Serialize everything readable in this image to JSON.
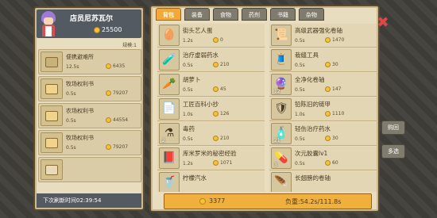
{
  "shop": {
    "title": "店员尼苏瓦尔",
    "coins": "25500",
    "level": "规模:1",
    "items": [
      {
        "name": "便携避难所",
        "time": "12.5s",
        "price": "6435"
      },
      {
        "name": "牧场权利书",
        "time": "0.5s",
        "price": "79207"
      },
      {
        "name": "农场权利书",
        "time": "0.5s",
        "price": "44554"
      },
      {
        "name": "牧场权利书",
        "time": "0.5s",
        "price": "79207"
      }
    ],
    "refresh": "下次刷新时间02:39:54"
  },
  "tabs": [
    "背包",
    "装备",
    "食物",
    "药剂",
    "书籍",
    "杂物"
  ],
  "active_tab": 0,
  "bag": {
    "items": [
      {
        "name": "街头艺人蛋",
        "time": "1.2s",
        "price": "0",
        "count": "",
        "icon": "egg-icon",
        "glyph": "🥚"
      },
      {
        "name": "高级武器强化卷轴",
        "time": "0.5s",
        "price": "1470",
        "count": "",
        "icon": "scroll-icon",
        "glyph": "📜"
      },
      {
        "name": "治疗虚弱药水",
        "time": "0.5s",
        "price": "210",
        "count": "",
        "icon": "potion-icon",
        "glyph": "🧪"
      },
      {
        "name": "栽缝工具",
        "time": "0.5s",
        "price": "30",
        "count": "",
        "icon": "sewing-tool-icon",
        "glyph": "🧵"
      },
      {
        "name": "胡萝卜",
        "time": "0.5s",
        "price": "45",
        "count": "",
        "icon": "carrot-icon",
        "glyph": "🥕"
      },
      {
        "name": "全净化卷轴",
        "time": "0.5s",
        "price": "147",
        "count": "12",
        "icon": "purify-scroll-icon",
        "glyph": "🔮"
      },
      {
        "name": "工匠百科小抄",
        "time": "1.0s",
        "price": "126",
        "count": "",
        "icon": "note-icon",
        "glyph": "📄"
      },
      {
        "name": "铅陈旧的链甲",
        "time": "1.0s",
        "price": "1110",
        "count": "",
        "icon": "armor-icon",
        "glyph": "🛡"
      },
      {
        "name": "毒药",
        "time": "0.5s",
        "price": "210",
        "count": "2",
        "icon": "poison-icon",
        "glyph": "⚗"
      },
      {
        "name": "轻伤治疗药水",
        "time": "0.5s",
        "price": "30",
        "count": "21",
        "icon": "heal-potion-icon",
        "glyph": "🧴"
      },
      {
        "name": "库米罗米的秘密经验",
        "time": "1.2s",
        "price": "1071",
        "count": "",
        "icon": "book-icon",
        "glyph": "📕"
      },
      {
        "name": "次元胶囊lv1",
        "time": "0.5s",
        "price": "60",
        "count": "3",
        "icon": "capsule-icon",
        "glyph": "💊"
      },
      {
        "name": "柠檬汽水",
        "time": "",
        "price": "",
        "count": "",
        "icon": "soda-icon",
        "glyph": "🥤"
      },
      {
        "name": "长翅膀的卷轴",
        "time": "",
        "price": "",
        "count": "",
        "icon": "wing-scroll-icon",
        "glyph": "🪶"
      }
    ],
    "gold": "3377",
    "weight": "负重:54.2s/111.8s"
  },
  "side_buttons": {
    "buy": "购回",
    "multi": "多选"
  },
  "close_label": "✖"
}
